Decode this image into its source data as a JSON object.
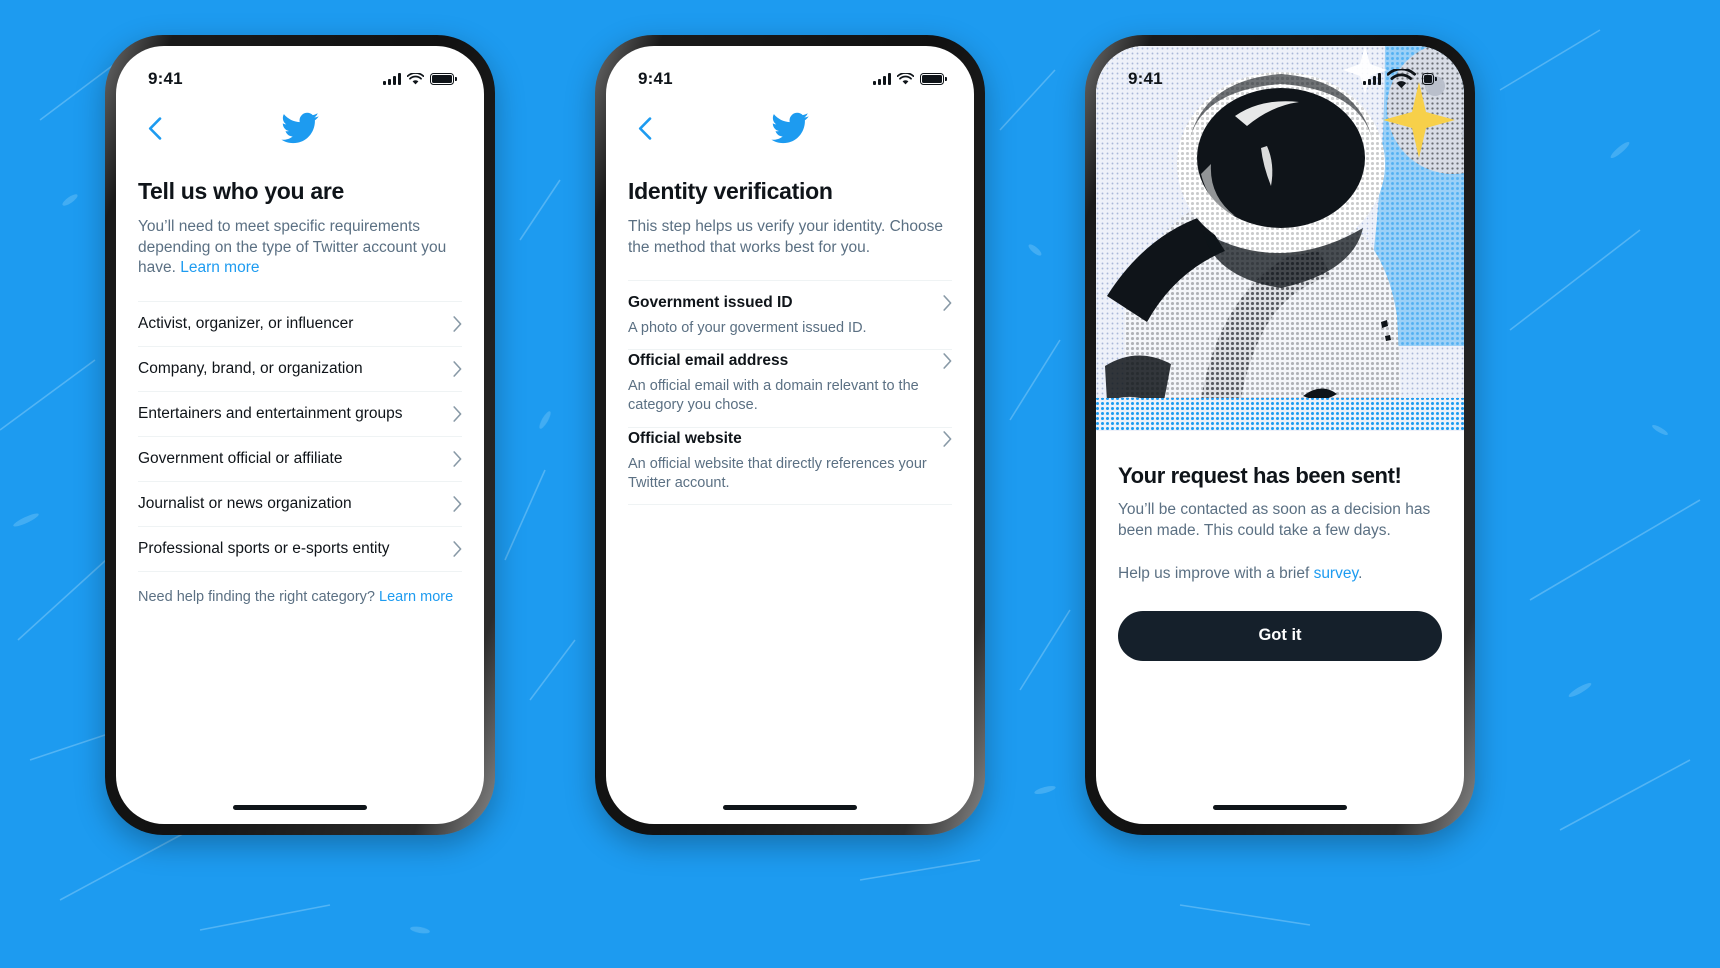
{
  "background": {
    "color": "#1d9bf0"
  },
  "status_bar": {
    "time": "9:41",
    "cellular_icon": "signal-bars-icon",
    "wifi_icon": "wifi-icon",
    "battery_icon": "battery-full-icon"
  },
  "phones": [
    {
      "id": "phone-1",
      "nav": {
        "back_icon": "chevron-left-icon",
        "logo_icon": "twitter-bird-icon"
      },
      "title": "Tell us who you are",
      "subtitle_text": "You’ll need to meet specific requirements depending on the type of Twitter account you have. ",
      "subtitle_link": "Learn more",
      "categories": [
        {
          "label": "Activist, organizer, or influencer",
          "chevron": "chevron-right-icon"
        },
        {
          "label": "Company, brand, or organization",
          "chevron": "chevron-right-icon"
        },
        {
          "label": "Entertainers and entertainment groups",
          "chevron": "chevron-right-icon"
        },
        {
          "label": "Government official or affiliate",
          "chevron": "chevron-right-icon"
        },
        {
          "label": "Journalist or news organization",
          "chevron": "chevron-right-icon"
        },
        {
          "label": "Professional sports or e-sports entity",
          "chevron": "chevron-right-icon"
        }
      ],
      "help_text": "Need help finding the right category? ",
      "help_link": "Learn more"
    },
    {
      "id": "phone-2",
      "nav": {
        "back_icon": "chevron-left-icon",
        "logo_icon": "twitter-bird-icon"
      },
      "title": "Identity verification",
      "subtitle_text": "This step helps us verify your identity. Choose the method that works best for you.",
      "methods": [
        {
          "title": "Government issued ID",
          "description": "A photo of your goverment issued ID.",
          "chevron": "chevron-right-icon"
        },
        {
          "title": "Official email address",
          "description": "An official email with a domain relevant to the category you chose.",
          "chevron": "chevron-right-icon"
        },
        {
          "title": "Official website",
          "description": "An official website that directly references your Twitter account.",
          "chevron": "chevron-right-icon"
        }
      ]
    },
    {
      "id": "phone-3",
      "hero_icon": "astronaut-halftone-illustration",
      "title": "Your request has been sent!",
      "subtitle": "You’ll be contacted as soon as a decision has been made. This could take a few days.",
      "survey_text": "Help us improve with a brief ",
      "survey_link": "survey",
      "survey_tail": ".",
      "cta_label": "Got it"
    }
  ],
  "colors": {
    "twitter_blue": "#1d9bf0",
    "text_primary": "#0f1419",
    "text_secondary": "#5b7083",
    "divider": "#eff3f4",
    "cta_background": "#15202b"
  }
}
